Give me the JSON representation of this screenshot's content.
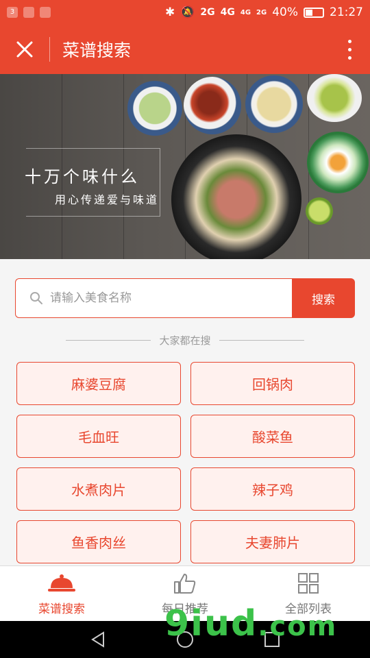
{
  "status_bar": {
    "notification_count": "3",
    "network_1": "2G",
    "network_2": "4G",
    "network_3": "4G",
    "network_4": "2G",
    "battery": "40%",
    "time": "21:27"
  },
  "app_bar": {
    "title": "菜谱搜索",
    "close_icon": "close-icon",
    "more_icon": "more-vertical-icon"
  },
  "banner": {
    "title": "十万个味什么",
    "subtitle": "用心传递爱与味道"
  },
  "search": {
    "placeholder": "请输入美食名称",
    "value": "",
    "button_label": "搜索"
  },
  "hot": {
    "heading": "大家都在搜",
    "items": [
      "麻婆豆腐",
      "回锅肉",
      "毛血旺",
      "酸菜鱼",
      "水煮肉片",
      "辣子鸡",
      "鱼香肉丝",
      "夫妻肺片"
    ]
  },
  "tabs": [
    {
      "label": "菜谱搜索",
      "icon": "dish-cover-icon",
      "active": true
    },
    {
      "label": "每日推荐",
      "icon": "thumbs-up-icon",
      "active": false
    },
    {
      "label": "全部列表",
      "icon": "grid-icon",
      "active": false
    }
  ],
  "watermark": {
    "text": "9iud",
    "domain": ".com"
  },
  "colors": {
    "accent": "#e8472f",
    "accent_bg": "#fff1ee"
  }
}
